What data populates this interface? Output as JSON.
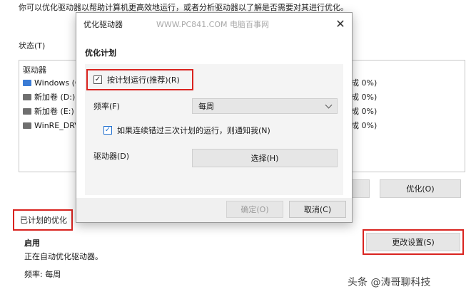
{
  "background": {
    "intro_text": "你可以优化驱动器以帮助计算机更高效地运行，或者分析驱动器以了解是否需要对其进行优化。",
    "status_label": "状态(T)",
    "drives_header": "驱动器",
    "drives": [
      {
        "name": "Windows (C",
        "icon": "windows-drive-icon",
        "status_fragment": "成 0%)"
      },
      {
        "name": "新加卷 (D:)",
        "icon": "hard-drive-icon",
        "status_fragment": "成 0%)"
      },
      {
        "name": "新加卷 (E:)",
        "icon": "hard-drive-icon",
        "status_fragment": "成 0%)"
      },
      {
        "name": "WinRE_DRV",
        "icon": "hard-drive-icon",
        "status_fragment": "成 0%)"
      }
    ],
    "optimize_button": "优化(O)",
    "scheduled_title": "已计划的优化",
    "scheduled_enabled": "启用",
    "scheduled_auto": "正在自动优化驱动器。",
    "scheduled_frequency": "频率: 每周",
    "change_settings_button": "更改设置(S)"
  },
  "dialog": {
    "title": "优化驱动器",
    "watermark": "WWW.PC841.COM 电脑百事网",
    "close_glyph": "✕",
    "plan_heading": "优化计划",
    "run_on_schedule": {
      "label": "按计划运行(推荐)(R)",
      "checked": true,
      "check_glyph": "✓"
    },
    "frequency_label": "频率(F)",
    "frequency_value": "每周",
    "notify": {
      "label": "如果连续错过三次计划的运行，则通知我(N)",
      "checked": true,
      "check_glyph": "✓"
    },
    "drives_label": "驱动器(D)",
    "choose_button": "选择(H)",
    "ok_button": "确定(O)",
    "cancel_button": "取消(C)"
  },
  "watermark_bottom": "头条 @涛哥聊科技",
  "colors": {
    "highlight_red": "#d9231f",
    "check_blue": "#1f6fd0"
  }
}
